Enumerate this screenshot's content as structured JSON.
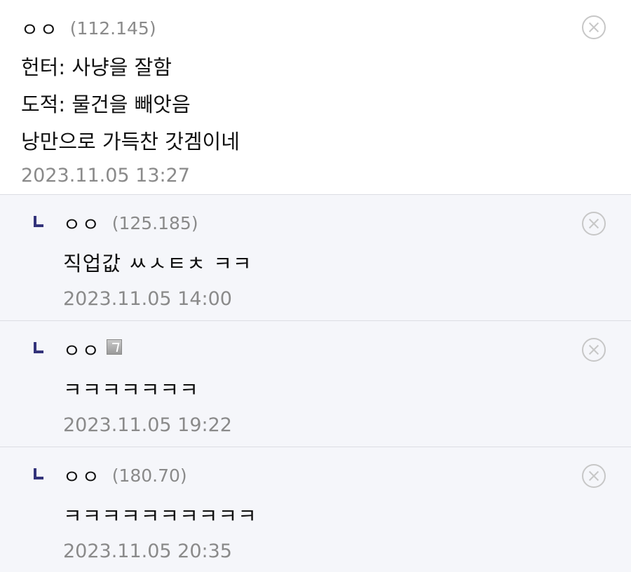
{
  "comments": [
    {
      "nick": "ㅇㅇ",
      "ip": "(112.145)",
      "lines": [
        "헌터: 사냥을 잘함",
        "도적: 물건을 빼앗음",
        "낭만으로 가득찬 갓겜이네"
      ],
      "date": "2023.11.05 13:27"
    }
  ],
  "replies": [
    {
      "nick": "ㅇㅇ",
      "ip": "(125.185)",
      "text": "직업값 ㅆㅅㅌㅊ ㅋㅋ",
      "date": "2023.11.05 14:00"
    },
    {
      "nick": "ㅇㅇ",
      "ip": "",
      "text": "ㅋㅋㅋㅋㅋㅋㅋ",
      "date": "2023.11.05 19:22",
      "icon": "gallog-icon"
    },
    {
      "nick": "ㅇㅇ",
      "ip": "(180.70)",
      "text": "ㅋㅋㅋㅋㅋㅋㅋㅋㅋㅋ",
      "date": "2023.11.05 20:35"
    }
  ],
  "icons": {
    "delete": "close-circle-icon",
    "reply": "reply-arrow-icon"
  },
  "colors": {
    "reply_background": "#f5f6fa",
    "reply_marker": "#33337a",
    "meta_text": "#8a8a8a",
    "divider": "#dcdde3"
  }
}
